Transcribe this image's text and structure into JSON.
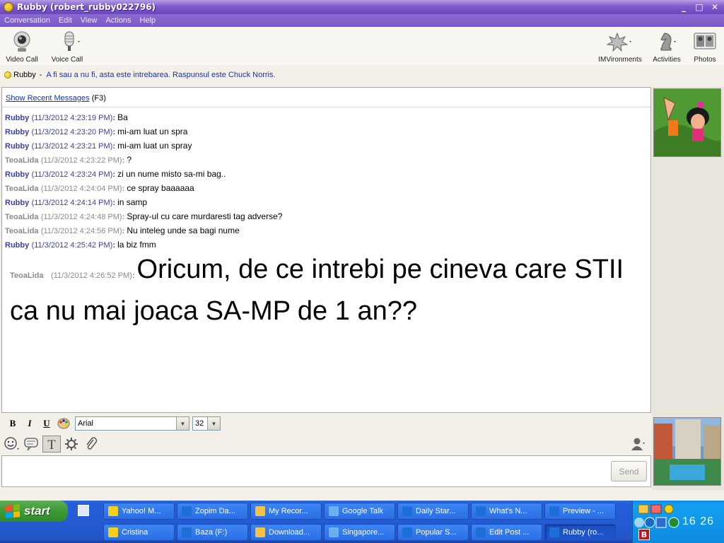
{
  "window": {
    "title": "Rubby (robert_rubby022796)",
    "minimize": "_",
    "maximize": "□",
    "close": "✕"
  },
  "menu": [
    "Conversation",
    "Edit",
    "View",
    "Actions",
    "Help"
  ],
  "toolbar": {
    "video_call": "Video Call",
    "voice_call": "Voice Call",
    "imvironments": "IMVironments",
    "activities": "Activities",
    "photos": "Photos"
  },
  "status": {
    "name": "Rubby",
    "separator": "-",
    "message": "A fi sau a nu fi, asta este intrebarea. Raspunsul este Chuck Norris."
  },
  "chat": {
    "show_recent": "Show Recent Messages",
    "shortcut": "(F3)",
    "messages": [
      {
        "sender": "Rubby",
        "time": "(11/3/2012 4:23:19 PM)",
        "text": "Ba",
        "who": "rb"
      },
      {
        "sender": "Rubby",
        "time": "(11/3/2012 4:23:20 PM)",
        "text": "mi-am luat un spra",
        "who": "rb"
      },
      {
        "sender": "Rubby",
        "time": "(11/3/2012 4:23:21 PM)",
        "text": "mi-am luat un spray",
        "who": "rb"
      },
      {
        "sender": "TeoaLida",
        "time": "(11/3/2012 4:23:22 PM)",
        "text": "?",
        "who": "tl"
      },
      {
        "sender": "Rubby",
        "time": "(11/3/2012 4:23:24 PM)",
        "text": "zi un nume misto sa-mi bag..",
        "who": "rb"
      },
      {
        "sender": "TeoaLida",
        "time": "(11/3/2012 4:24:04 PM)",
        "text": "ce spray baaaaaa",
        "who": "tl"
      },
      {
        "sender": "Rubby",
        "time": "(11/3/2012 4:24:14 PM)",
        "text": "in samp",
        "who": "rb"
      },
      {
        "sender": "TeoaLida",
        "time": "(11/3/2012 4:24:48 PM)",
        "text": "Spray-ul cu care murdaresti tag adverse?",
        "who": "tl"
      },
      {
        "sender": "TeoaLida",
        "time": "(11/3/2012 4:24:56 PM)",
        "text": "Nu inteleg unde sa bagi nume",
        "who": "tl"
      },
      {
        "sender": "Rubby",
        "time": "(11/3/2012 4:25:42 PM)",
        "text": "la biz fmm",
        "who": "rb"
      }
    ],
    "last": {
      "sender": "TeoaLida",
      "time": "(11/3/2012 4:26:52 PM)",
      "text": "Oricum, de ce intrebi pe cineva care STII ca nu mai joaca SA-MP de 1 an??"
    }
  },
  "format": {
    "bold": "B",
    "italic": "I",
    "underline": "U",
    "font": "Arial",
    "size": "32"
  },
  "input": {
    "send": "Send"
  },
  "taskbar": {
    "start": "start",
    "row1": [
      "Yahoo! M...",
      "Zopim Da...",
      "My Recor...",
      "Google Talk",
      "Daily Star...",
      "What's N...",
      "Preview - ..."
    ],
    "row2": [
      "Cristina",
      "Baza (F:)",
      "Download...",
      "Singapore...",
      "Popular S...",
      "Edit Post ...",
      "Rubby (ro..."
    ],
    "clock": "16 26"
  }
}
